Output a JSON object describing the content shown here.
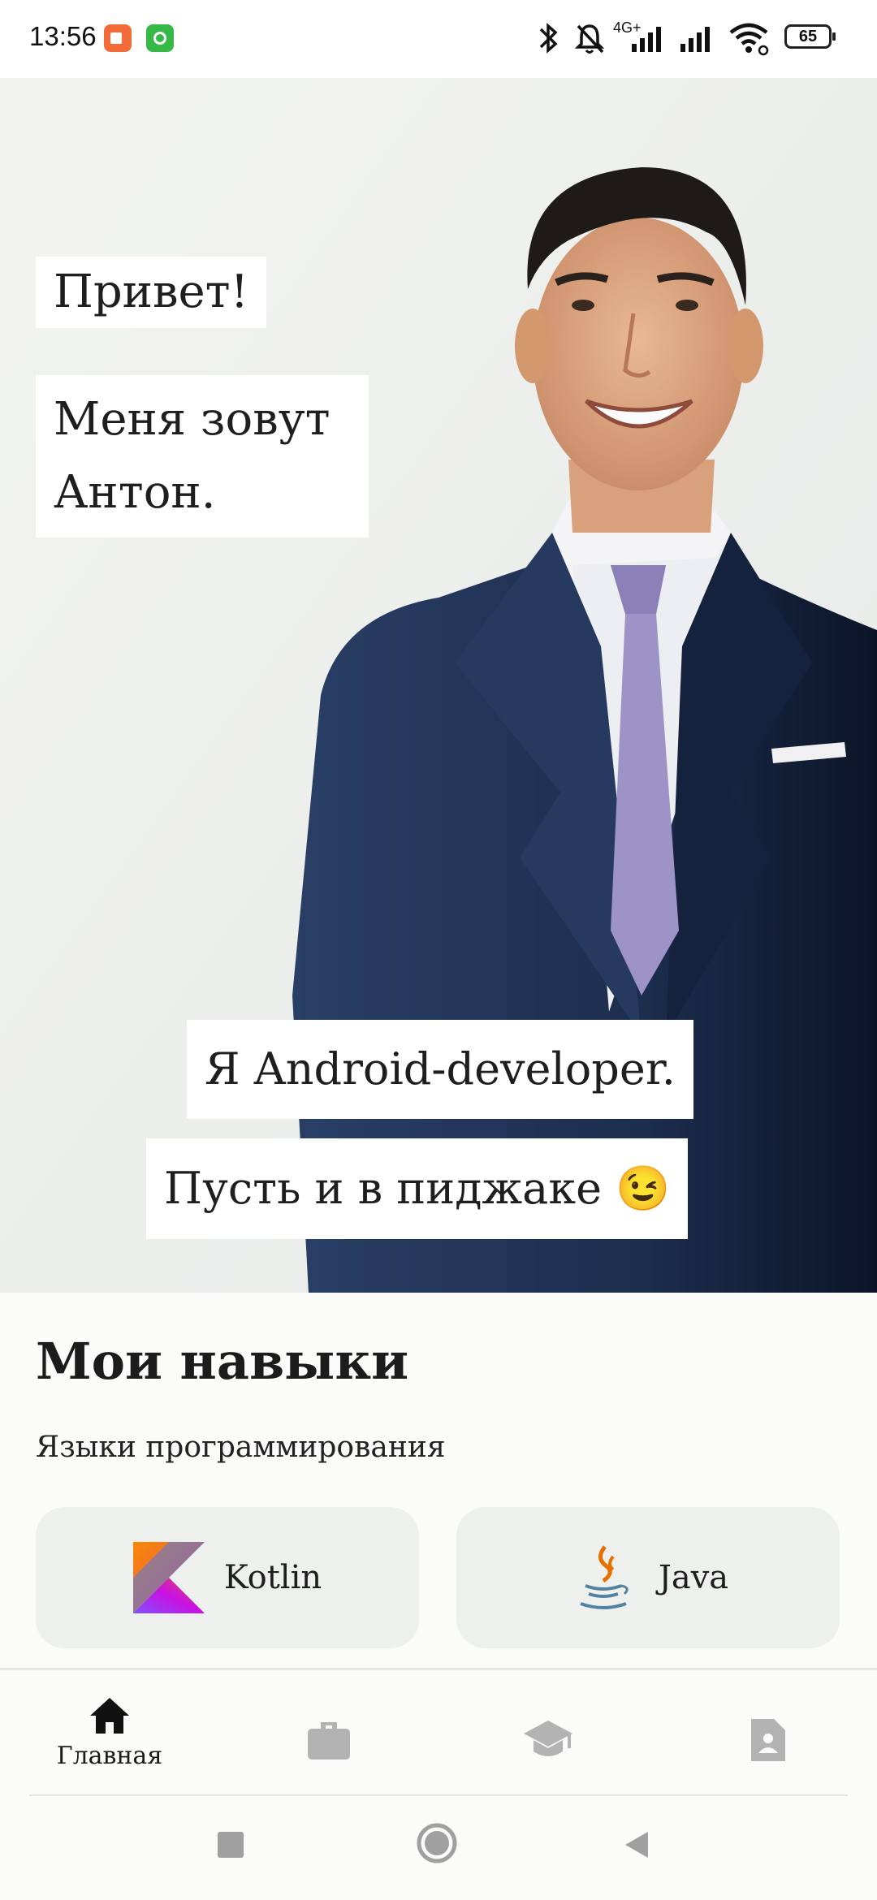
{
  "status_bar": {
    "time": "13:56",
    "network_label": "4G+",
    "battery": "65",
    "icons": [
      "video-recorder-notification-icon",
      "robot-notification-icon",
      "bluetooth-icon",
      "muted-bell-icon",
      "signal-icon",
      "signal-icon-2",
      "wifi-icon",
      "battery-icon"
    ]
  },
  "hero": {
    "greeting": "Привет!",
    "name_line1": "Меня зовут",
    "name_line2": "Антон.",
    "role": "Я Android-developer.",
    "tagline": "Пусть и в пиджаке 😉"
  },
  "skills": {
    "title": "Мои навыки",
    "subtitle": "Языки программирования",
    "languages": [
      {
        "name": "Kotlin",
        "icon": "kotlin-logo-icon"
      },
      {
        "name": "Java",
        "icon": "java-logo-icon"
      }
    ]
  },
  "bottom_nav": {
    "items": [
      {
        "label": "Главная",
        "icon": "home-icon",
        "active": true
      },
      {
        "label": "",
        "icon": "briefcase-icon",
        "active": false
      },
      {
        "label": "",
        "icon": "graduation-cap-icon",
        "active": false
      },
      {
        "label": "",
        "icon": "contact-card-icon",
        "active": false
      }
    ]
  },
  "colors": {
    "hero_background": "#eef0ee",
    "card_background": "#eef0ee",
    "inactive_icon": "#b3b3b3",
    "active_icon": "#111111",
    "suit": "#1f3153",
    "tie": "#9d93c6"
  }
}
